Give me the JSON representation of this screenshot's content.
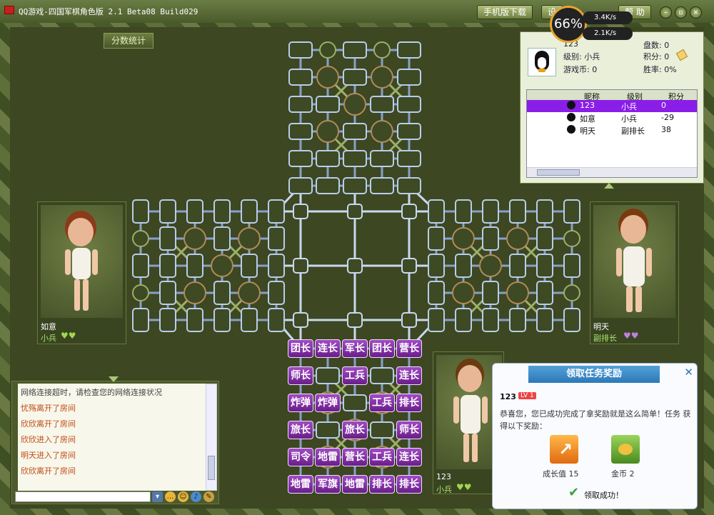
{
  "window": {
    "title": "QQ游戏-四国军棋角色版 2.1 Beta08 Build029",
    "mobile_download": "手机版下载",
    "settings_label": "设",
    "help_label": "帮 助",
    "minimize": "–",
    "restore": "▫",
    "close": "×"
  },
  "network": {
    "percent": "66%",
    "up_speed": "3.4K/s",
    "down_speed": "2.1K/s"
  },
  "score_tab": "分数统计",
  "self_info": {
    "id_partial": "123",
    "level_label": "级别: 小兵",
    "coins_label": "游戏币: 0",
    "games_label": "盘数: 0",
    "score_label": "积分: 0",
    "winrate_label": "胜率: 0%"
  },
  "rank_table": {
    "headers": [
      "昵称",
      "级别",
      "积分"
    ],
    "rows": [
      {
        "name": "123",
        "rank": "小兵",
        "score": "0",
        "selected": true
      },
      {
        "name": "如意",
        "rank": "小兵",
        "score": "-29",
        "selected": false
      },
      {
        "name": "明天",
        "rank": "副排长",
        "score": "38",
        "selected": false
      }
    ]
  },
  "players": {
    "left": {
      "name": "如意",
      "rank": "小兵"
    },
    "right": {
      "name": "明天",
      "rank": "副排长"
    },
    "bottom": {
      "name": "123",
      "rank": "小兵"
    }
  },
  "pieces": [
    [
      "团长",
      "连长",
      "军长",
      "团长",
      "营长"
    ],
    [
      "师长",
      "",
      "工兵",
      "",
      "连长"
    ],
    [
      "炸弹",
      "炸弹",
      "",
      "工兵",
      "排长"
    ],
    [
      "旅长",
      "",
      "旅长",
      "",
      "师长"
    ],
    [
      "司令",
      "地雷",
      "营长",
      "工兵",
      "连长"
    ],
    [
      "地雷",
      "军旗",
      "地雷",
      "排长",
      "排长"
    ]
  ],
  "chat": {
    "lines": [
      "网络连接超时，请检查您的网络连接状况",
      "忧殇离开了房间",
      "欣欣离开了房间",
      "欣欣进入了房间",
      "明天进入了房间",
      "欣欣离开了房间"
    ]
  },
  "reward": {
    "title": "领取任务奖励",
    "user": "123",
    "level": "LV 1",
    "message": "恭喜您，您已成功完成了拿奖励就是这么简单！任务 获得以下奖励：",
    "item1_label": "成长值 15",
    "item2_label": "金币 2",
    "success": "领取成功！"
  }
}
